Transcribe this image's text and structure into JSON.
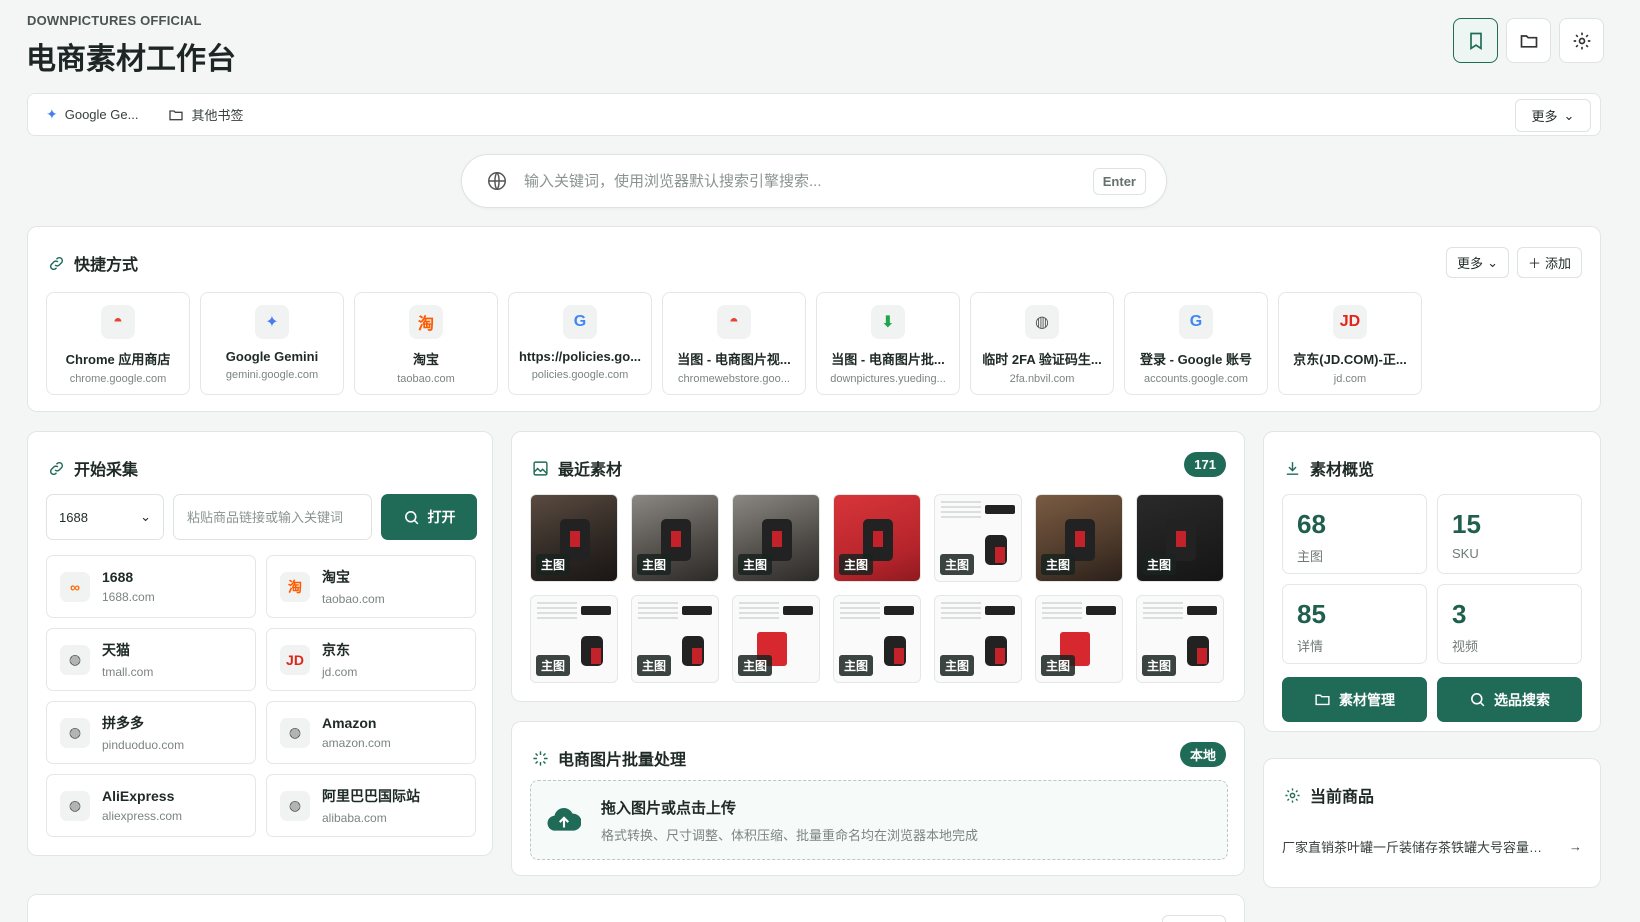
{
  "header": {
    "brand_small": "DOWNPICTURES OFFICIAL",
    "title": "电商素材工作台"
  },
  "bookmarks": {
    "items": [
      {
        "label": "Google Ge...",
        "icon": "gemini-icon"
      },
      {
        "label": "其他书签",
        "icon": "folder-icon"
      }
    ],
    "more_label": "更多"
  },
  "search": {
    "placeholder": "输入关键词，使用浏览器默认搜索引擎搜索...",
    "enter_label": "Enter"
  },
  "shortcuts": {
    "title": "快捷方式",
    "more_label": "更多",
    "add_label": "添加",
    "items": [
      {
        "name": "Chrome 应用商店",
        "domain": "chrome.google.com",
        "icon": "chrome-webstore-icon",
        "glyph": "◓",
        "color": "#e94235"
      },
      {
        "name": "Google Gemini",
        "domain": "gemini.google.com",
        "icon": "gemini-icon",
        "glyph": "✦",
        "color": "#4a7cf0"
      },
      {
        "name": "淘宝",
        "domain": "taobao.com",
        "icon": "taobao-icon",
        "glyph": "淘",
        "color": "#ff5a00"
      },
      {
        "name": "https://policies.go...",
        "domain": "policies.google.com",
        "icon": "google-icon",
        "glyph": "G",
        "color": "#4285f4"
      },
      {
        "name": "当图 - 电商图片视...",
        "domain": "chromewebstore.goo...",
        "icon": "chrome-webstore-icon",
        "glyph": "◓",
        "color": "#e94235"
      },
      {
        "name": "当图 - 电商图片批...",
        "domain": "downpictures.yueding...",
        "icon": "downpictures-icon",
        "glyph": "⬇",
        "color": "#1fa54a"
      },
      {
        "name": "临时 2FA 验证码生...",
        "domain": "2fa.nbvil.com",
        "icon": "globe-icon",
        "glyph": "◍",
        "color": "#555"
      },
      {
        "name": "登录 - Google 账号",
        "domain": "accounts.google.com",
        "icon": "google-icon",
        "glyph": "G",
        "color": "#4285f4"
      },
      {
        "name": "京东(JD.COM)-正...",
        "domain": "jd.com",
        "icon": "jd-icon",
        "glyph": "JD",
        "color": "#e1251b"
      }
    ]
  },
  "collect": {
    "title": "开始采集",
    "select_value": "1688",
    "input_placeholder": "粘贴商品链接或输入关键词",
    "open_label": "打开",
    "sites": [
      {
        "name": "1688",
        "domain": "1688.com",
        "icon": "1688-icon",
        "glyph": "∞",
        "color": "#ff6a00"
      },
      {
        "name": "淘宝",
        "domain": "taobao.com",
        "icon": "taobao-icon",
        "glyph": "淘",
        "color": "#ff5a00"
      },
      {
        "name": "天猫",
        "domain": "tmall.com",
        "icon": "globe-icon",
        "glyph": "◍",
        "color": "#555"
      },
      {
        "name": "京东",
        "domain": "jd.com",
        "icon": "jd-icon",
        "glyph": "JD",
        "color": "#e1251b"
      },
      {
        "name": "拼多多",
        "domain": "pinduoduo.com",
        "icon": "globe-icon",
        "glyph": "◍",
        "color": "#555"
      },
      {
        "name": "Amazon",
        "domain": "amazon.com",
        "icon": "globe-icon",
        "glyph": "◍",
        "color": "#555"
      },
      {
        "name": "AliExpress",
        "domain": "aliexpress.com",
        "icon": "globe-icon",
        "glyph": "◍",
        "color": "#555"
      },
      {
        "name": "阿里巴巴国际站",
        "domain": "alibaba.com",
        "icon": "globe-icon",
        "glyph": "◍",
        "color": "#555"
      }
    ]
  },
  "recent": {
    "title": "最近素材",
    "count": "171",
    "thumbs": [
      {
        "tag": "主图",
        "style": "th-dark"
      },
      {
        "tag": "主图",
        "style": "th-grey"
      },
      {
        "tag": "主图",
        "style": "th-grey"
      },
      {
        "tag": "主图",
        "style": "th-red"
      },
      {
        "tag": "主图",
        "style": "th-white"
      },
      {
        "tag": "主图",
        "style": "th-wood"
      },
      {
        "tag": "主图",
        "style": "th-black"
      },
      {
        "tag": "主图",
        "style": "th-white"
      },
      {
        "tag": "主图",
        "style": "th-white"
      },
      {
        "tag": "主图",
        "style": "th-white"
      },
      {
        "tag": "主图",
        "style": "th-white"
      },
      {
        "tag": "主图",
        "style": "th-white"
      },
      {
        "tag": "主图",
        "style": "th-white"
      },
      {
        "tag": "主图",
        "style": "th-white"
      }
    ]
  },
  "batch": {
    "title": "电商图片批量处理",
    "badge": "本地",
    "drop_title": "拖入图片或点击上传",
    "drop_sub": "格式转换、尺寸调整、体积压缩、批量重命名均在浏览器本地完成"
  },
  "overview": {
    "title": "素材概览",
    "stats": [
      {
        "value": "68",
        "label": "主图"
      },
      {
        "value": "15",
        "label": "SKU"
      },
      {
        "value": "85",
        "label": "详情"
      },
      {
        "value": "3",
        "label": "视频"
      }
    ],
    "manage_label": "素材管理",
    "search_label": "选品搜索"
  },
  "current": {
    "title": "当前商品",
    "product": "厂家直销茶叶罐一斤装储存茶铁罐大号容量金..."
  },
  "colors": {
    "accent": "#1f6b57",
    "background": "#f4f6f5"
  }
}
